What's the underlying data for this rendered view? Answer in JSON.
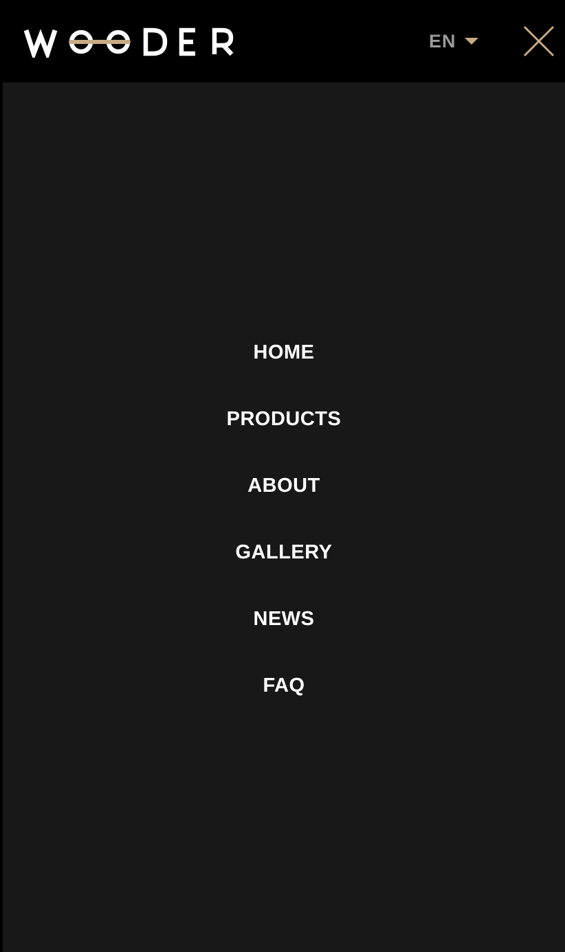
{
  "header": {
    "brand": "WOODER",
    "language": "EN",
    "colors": {
      "accent": "#c8aa84",
      "language_text": "#9a9a9a",
      "background": "#000000",
      "panel": "#181818"
    }
  },
  "nav": {
    "items": [
      {
        "label": "HOME"
      },
      {
        "label": "PRODUCTS"
      },
      {
        "label": "ABOUT"
      },
      {
        "label": "GALLERY"
      },
      {
        "label": "NEWS"
      },
      {
        "label": "FAQ"
      }
    ]
  },
  "icons": {
    "close": "close-icon",
    "caret": "chevron-down-icon"
  }
}
